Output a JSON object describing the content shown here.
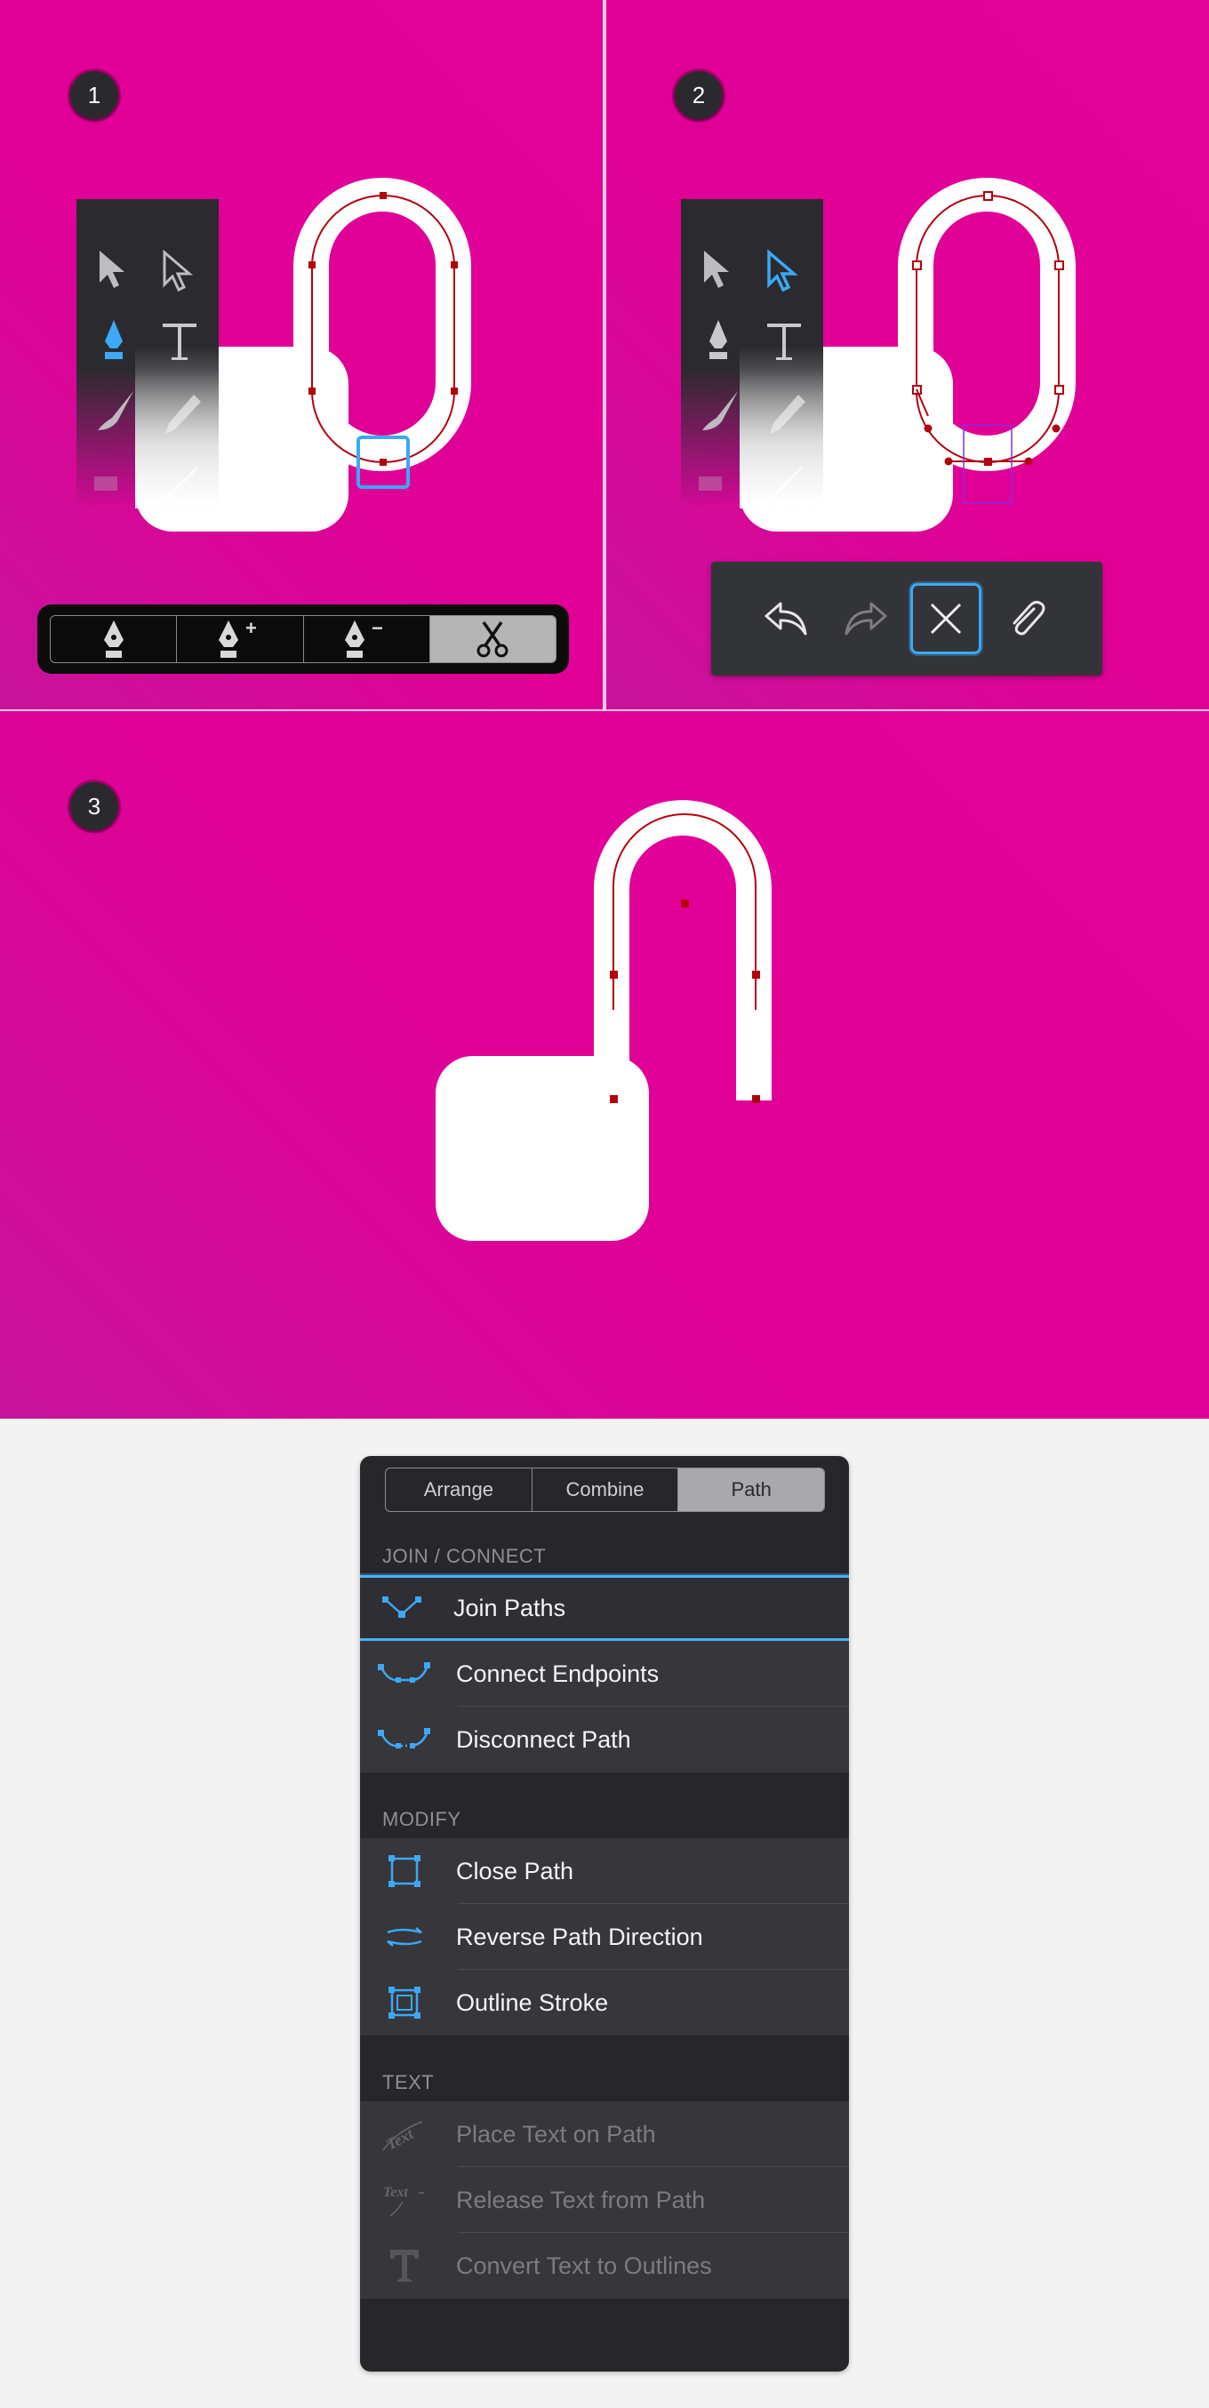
{
  "steps": [
    "1",
    "2",
    "3"
  ],
  "colors": {
    "canvas_background": "#e10096",
    "path_stroke": "#b3000f",
    "selection_blue": "#3ba9f5",
    "menu_background": "#27272b"
  },
  "panel1": {
    "toolbar_icons": [
      "arrow-icon",
      "direct-select-icon",
      "pen-icon",
      "text-icon",
      "brush-icon",
      "pencil-icon",
      "eraser-icon",
      "line-icon"
    ],
    "active_tool": "pen-icon",
    "pen_bar": {
      "segments": [
        {
          "icon": "pen-icon",
          "mark": ""
        },
        {
          "icon": "pen-add-icon",
          "mark": "+"
        },
        {
          "icon": "pen-remove-icon",
          "mark": "−"
        },
        {
          "icon": "scissors-icon",
          "mark": ""
        }
      ],
      "active_segment": "scissors-icon"
    }
  },
  "panel2": {
    "toolbar_icons": [
      "arrow-icon",
      "direct-select-icon",
      "pen-icon",
      "text-icon",
      "brush-icon",
      "pencil-icon",
      "eraser-icon",
      "line-icon"
    ],
    "active_tool": "direct-select-icon",
    "action_bar": [
      "undo-icon",
      "redo-icon",
      "delete-icon",
      "paperclip-icon"
    ],
    "selected_action": "delete-icon"
  },
  "menu": {
    "tabs": [
      "Arrange",
      "Combine",
      "Path"
    ],
    "active_tab": "Path",
    "sections": [
      {
        "label": "JOIN / CONNECT",
        "items": [
          {
            "label": "Join Paths",
            "icon": "join-paths-icon",
            "enabled": true,
            "selected": true
          },
          {
            "label": "Connect Endpoints",
            "icon": "connect-endpoints-icon",
            "enabled": true,
            "selected": false
          },
          {
            "label": "Disconnect Path",
            "icon": "disconnect-path-icon",
            "enabled": true,
            "selected": false
          }
        ]
      },
      {
        "label": "MODIFY",
        "items": [
          {
            "label": "Close Path",
            "icon": "close-path-icon",
            "enabled": true,
            "selected": false
          },
          {
            "label": "Reverse Path Direction",
            "icon": "reverse-direction-icon",
            "enabled": true,
            "selected": false
          },
          {
            "label": "Outline Stroke",
            "icon": "outline-stroke-icon",
            "enabled": true,
            "selected": false
          }
        ]
      },
      {
        "label": "TEXT",
        "items": [
          {
            "label": "Place Text on Path",
            "icon": "text-on-path-icon",
            "enabled": false,
            "selected": false
          },
          {
            "label": "Release Text from Path",
            "icon": "release-text-icon",
            "enabled": false,
            "selected": false
          },
          {
            "label": "Convert Text to Outlines",
            "icon": "convert-text-icon",
            "enabled": false,
            "selected": false
          }
        ]
      }
    ]
  }
}
